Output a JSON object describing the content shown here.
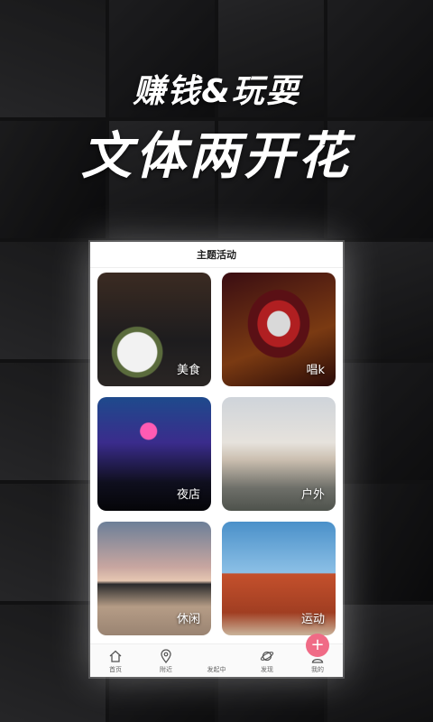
{
  "promo": {
    "line1": "赚钱&玩耍",
    "line2": "文体两开花"
  },
  "app": {
    "title": "主题活动",
    "categories": [
      {
        "label": "美食"
      },
      {
        "label": "唱k"
      },
      {
        "label": "夜店"
      },
      {
        "label": "户外"
      },
      {
        "label": "休闲"
      },
      {
        "label": "运动"
      }
    ],
    "tabbar": {
      "home": "首页",
      "nearby": "附近",
      "publish": "发起中",
      "discover": "发现",
      "mine": "我的",
      "publish_icon": "+"
    }
  },
  "colors": {
    "accent": "#f06b86"
  }
}
